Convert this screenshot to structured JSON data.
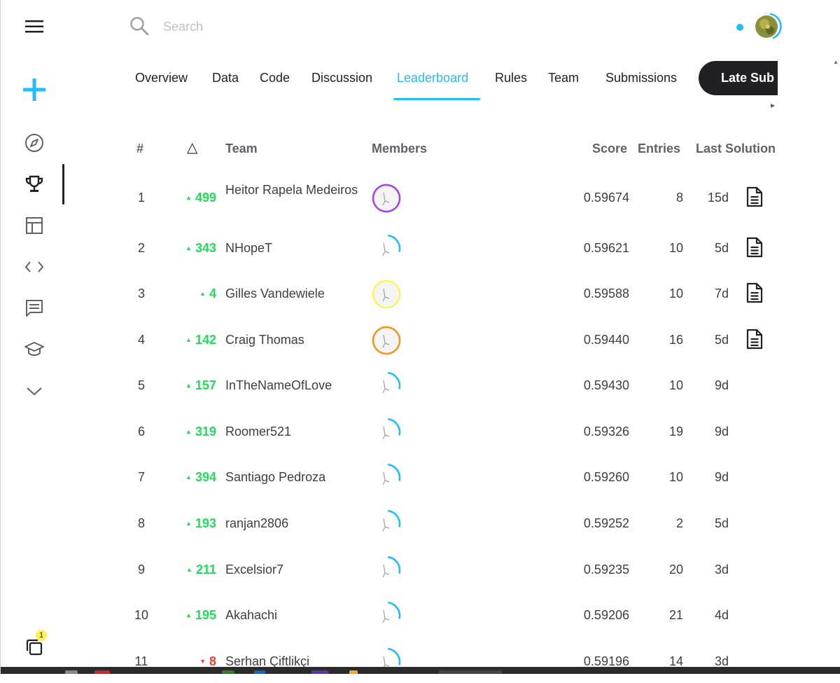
{
  "search": {
    "placeholder": "Search"
  },
  "tabs": [
    {
      "label": "Overview",
      "active": false
    },
    {
      "label": "Data",
      "active": false
    },
    {
      "label": "Code",
      "active": false
    },
    {
      "label": "Discussion",
      "active": false
    },
    {
      "label": "Leaderboard",
      "active": true
    },
    {
      "label": "Rules",
      "active": false
    },
    {
      "label": "Team",
      "active": false
    },
    {
      "label": "Submissions",
      "active": false
    }
  ],
  "late_submission_label": "Late Sub",
  "sidebar": {
    "icons": [
      "menu-icon",
      "create-icon",
      "compass-icon",
      "trophy-icon",
      "table-icon",
      "code-icon",
      "comment-icon",
      "graduation-cap-icon",
      "chevron-down-icon"
    ],
    "active": "trophy-icon",
    "notification_count": "1"
  },
  "columns": {
    "rank": "#",
    "delta": "△",
    "team": "Team",
    "members": "Members",
    "score": "Score",
    "entries": "Entries",
    "last": "Last Solution"
  },
  "colors": {
    "accent": "#20beff",
    "up": "#1ede5a",
    "down": "#ea4335",
    "dark": "#202124"
  },
  "rows": [
    {
      "rank": "1",
      "dir": "up",
      "delta": "499",
      "team": "Heitor Rapela Medeiros",
      "score": "0.59674",
      "entries": "8",
      "last": "15d",
      "has_solution": true,
      "ring": "#a142f4"
    },
    {
      "rank": "2",
      "dir": "up",
      "delta": "343",
      "team": "NHopeT",
      "score": "0.59621",
      "entries": "10",
      "last": "5d",
      "has_solution": true,
      "ring": "#20beff"
    },
    {
      "rank": "3",
      "dir": "up",
      "delta": "4",
      "team": "Gilles Vandewiele",
      "score": "0.59588",
      "entries": "10",
      "last": "7d",
      "has_solution": true,
      "ring": "#fff159"
    },
    {
      "rank": "4",
      "dir": "up",
      "delta": "142",
      "team": "Craig Thomas",
      "score": "0.59440",
      "entries": "16",
      "last": "5d",
      "has_solution": true,
      "ring": "#f7931e"
    },
    {
      "rank": "5",
      "dir": "up",
      "delta": "157",
      "team": "InTheNameOfLove",
      "score": "0.59430",
      "entries": "10",
      "last": "9d",
      "has_solution": false,
      "ring": "#20beff"
    },
    {
      "rank": "6",
      "dir": "up",
      "delta": "319",
      "team": "Roomer521",
      "score": "0.59326",
      "entries": "19",
      "last": "9d",
      "has_solution": false,
      "ring": "#20beff"
    },
    {
      "rank": "7",
      "dir": "up",
      "delta": "394",
      "team": "Santiago Pedroza",
      "score": "0.59260",
      "entries": "10",
      "last": "9d",
      "has_solution": false,
      "ring": "#20beff"
    },
    {
      "rank": "8",
      "dir": "up",
      "delta": "193",
      "team": "ranjan2806",
      "score": "0.59252",
      "entries": "2",
      "last": "5d",
      "has_solution": false,
      "ring": "#20beff"
    },
    {
      "rank": "9",
      "dir": "up",
      "delta": "211",
      "team": "Excelsior7",
      "score": "0.59235",
      "entries": "20",
      "last": "3d",
      "has_solution": false,
      "ring": "#20beff"
    },
    {
      "rank": "10",
      "dir": "up",
      "delta": "195",
      "team": "Akahachi",
      "score": "0.59206",
      "entries": "21",
      "last": "4d",
      "has_solution": false,
      "ring": "#20beff"
    },
    {
      "rank": "11",
      "dir": "down",
      "delta": "8",
      "team": "Serhan Çiftlikçi",
      "score": "0.59196",
      "entries": "14",
      "last": "3d",
      "has_solution": false,
      "ring": "#20beff"
    }
  ]
}
